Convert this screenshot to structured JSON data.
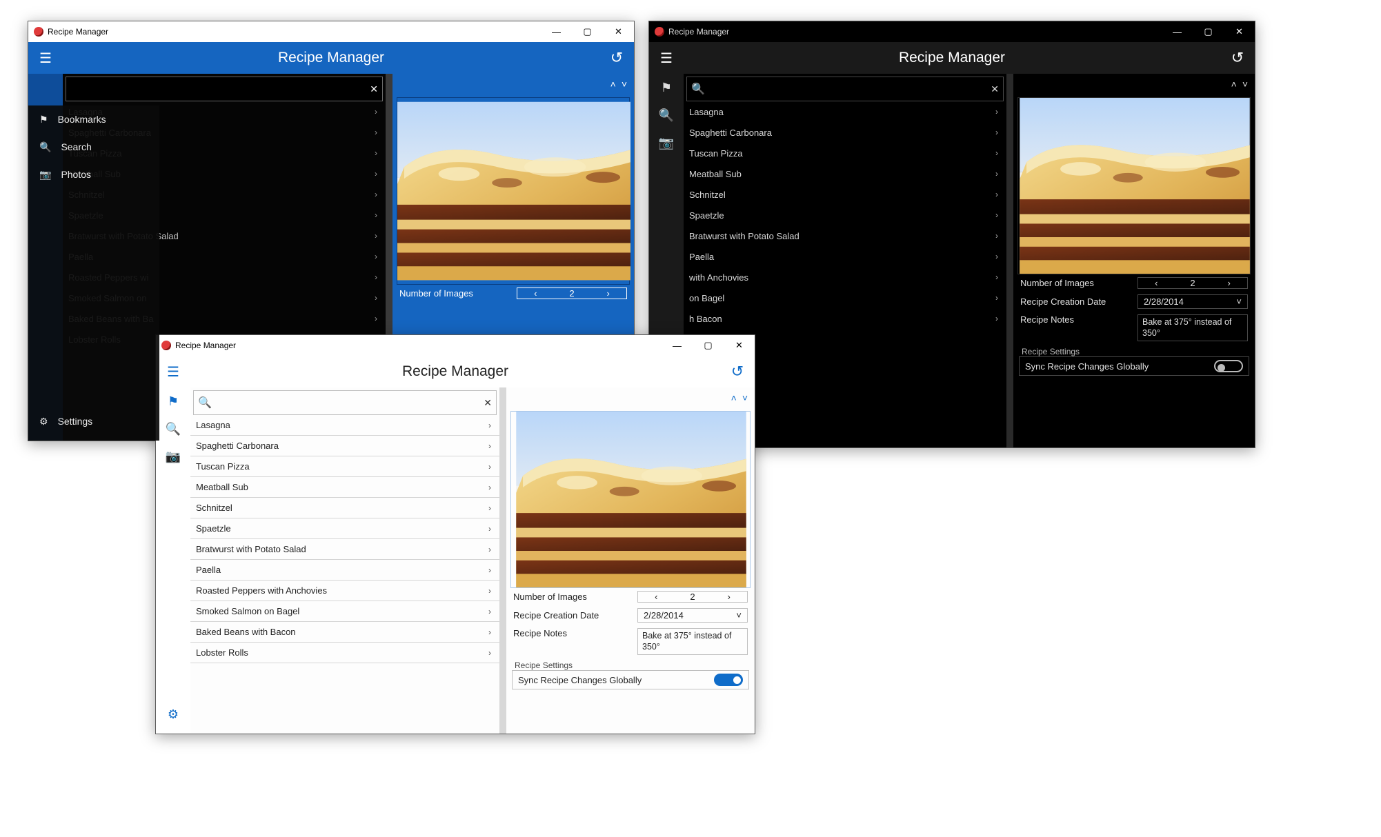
{
  "app_title": "Recipe Manager",
  "header_title": "Recipe Manager",
  "nav": {
    "bookmarks": "Bookmarks",
    "search": "Search",
    "photos": "Photos",
    "settings": "Settings"
  },
  "recipes": [
    "Lasagna",
    "Spaghetti Carbonara",
    "Tuscan Pizza",
    "Meatball Sub",
    "Schnitzel",
    "Spaetzle",
    "Bratwurst with Potato Salad",
    "Paella",
    "Roasted Peppers with Anchovies",
    "Smoked Salmon on Bagel",
    "Baked Beans with Bacon",
    "Lobster Rolls"
  ],
  "recipes_w1": [
    "Lasagna",
    "Spaghetti Carbonara",
    "Tuscan Pizza",
    "Meatball Sub",
    "Schnitzel",
    "Spaetzle",
    "Bratwurst with Potato Salad",
    "Paella",
    "Roasted Peppers wi",
    "Smoked Salmon on",
    "Baked Beans with Ba",
    "Lobster Rolls"
  ],
  "recipes_w2_tail": [
    "   with Anchovies",
    "   on Bagel",
    "   h Bacon"
  ],
  "detail": {
    "num_images_label": "Number of Images",
    "num_images_value": "2",
    "creation_date_label": "Recipe Creation Date",
    "creation_date_value": "2/28/2014",
    "notes_label": "Recipe Notes",
    "notes_value": "Bake at 375° instead of 350°",
    "settings_label": "Recipe Settings",
    "sync_label": "Sync Recipe Changes Globally"
  }
}
